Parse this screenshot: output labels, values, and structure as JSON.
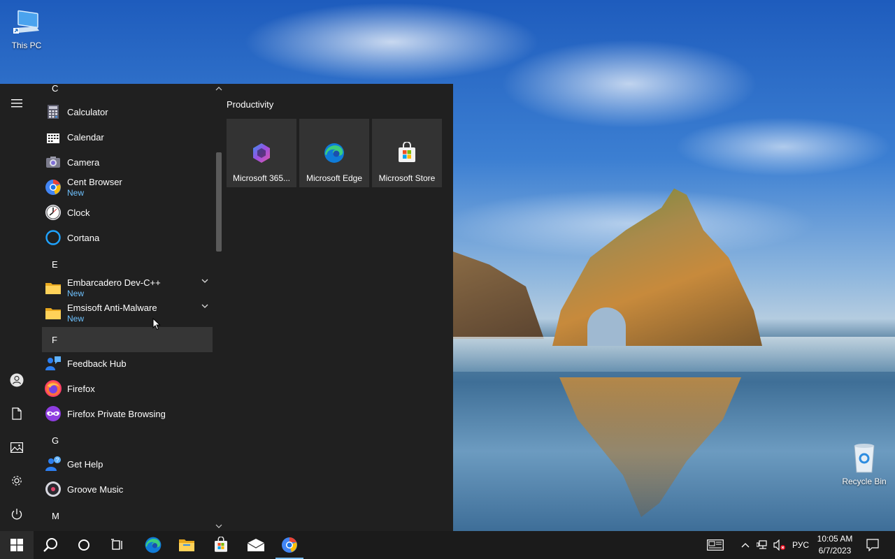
{
  "desktop": {
    "icons": [
      {
        "label": "This PC",
        "icon": "this-pc-icon"
      },
      {
        "label": "Recycle Bin",
        "icon": "recycle-bin-icon"
      }
    ]
  },
  "start_menu": {
    "rail": [
      {
        "name": "expand",
        "icon": "hamburger-menu-icon"
      },
      {
        "name": "account",
        "icon": "user-account-icon"
      },
      {
        "name": "documents",
        "icon": "document-icon"
      },
      {
        "name": "pictures",
        "icon": "pictures-icon"
      },
      {
        "name": "settings",
        "icon": "gear-icon"
      },
      {
        "name": "power",
        "icon": "power-icon"
      }
    ],
    "app_list": {
      "letters": {
        "c": "C",
        "e": "E",
        "f": "F",
        "g": "G",
        "m": "M"
      },
      "apps": {
        "calculator": {
          "name": "Calculator"
        },
        "calendar": {
          "name": "Calendar"
        },
        "camera": {
          "name": "Camera"
        },
        "cent_browser": {
          "name": "Cent Browser",
          "badge": "New"
        },
        "clock": {
          "name": "Clock"
        },
        "cortana": {
          "name": "Cortana"
        },
        "embarcadero": {
          "name": "Embarcadero Dev-C++",
          "badge": "New"
        },
        "emsisoft": {
          "name": "Emsisoft Anti-Malware",
          "badge": "New"
        },
        "feedback_hub": {
          "name": "Feedback Hub"
        },
        "firefox": {
          "name": "Firefox"
        },
        "firefox_private": {
          "name": "Firefox Private Browsing"
        },
        "get_help": {
          "name": "Get Help"
        },
        "groove": {
          "name": "Groove Music"
        }
      }
    },
    "tiles": {
      "group_title": "Productivity",
      "items": [
        {
          "label": "Microsoft 365...",
          "icon": "microsoft-365-icon"
        },
        {
          "label": "Microsoft Edge",
          "icon": "edge-icon"
        },
        {
          "label": "Microsoft Store",
          "icon": "store-icon"
        }
      ]
    }
  },
  "taskbar": {
    "pinned": [
      "start-icon",
      "search-icon",
      "cortana-icon",
      "task-view-icon",
      "edge-icon",
      "file-explorer-icon",
      "store-icon",
      "mail-icon",
      "cent-browser-icon"
    ],
    "tray": {
      "language": "РУС",
      "time": "10:05 AM",
      "date": "6/7/2023"
    }
  },
  "colors": {
    "menu_bg": "#202020",
    "tile_bg": "#333333",
    "taskbar_bg": "#1b1b1b",
    "badge_new": "#6ec2ff",
    "accent": "#76b9ed"
  }
}
